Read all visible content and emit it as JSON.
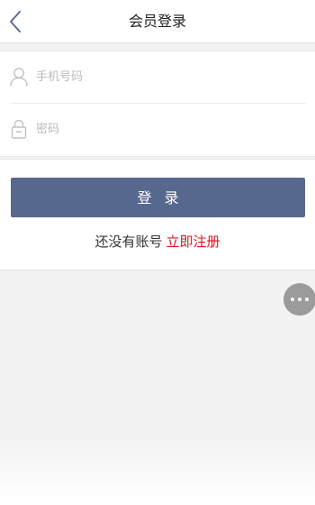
{
  "header": {
    "title": "会员登录",
    "back_icon": "chevron-left-icon"
  },
  "form": {
    "phone": {
      "placeholder": "手机号码",
      "value": "",
      "icon": "user-icon"
    },
    "password": {
      "placeholder": "密码",
      "value": "",
      "icon": "lock-icon"
    }
  },
  "actions": {
    "login_label": "登录",
    "register_prompt": "还没有账号",
    "register_link": "立即注册"
  },
  "floating_menu": {
    "icon": "more-horizontal-icon"
  },
  "colors": {
    "accent": "#57688f",
    "link": "#d9121b",
    "background": "#f2f2f2"
  }
}
